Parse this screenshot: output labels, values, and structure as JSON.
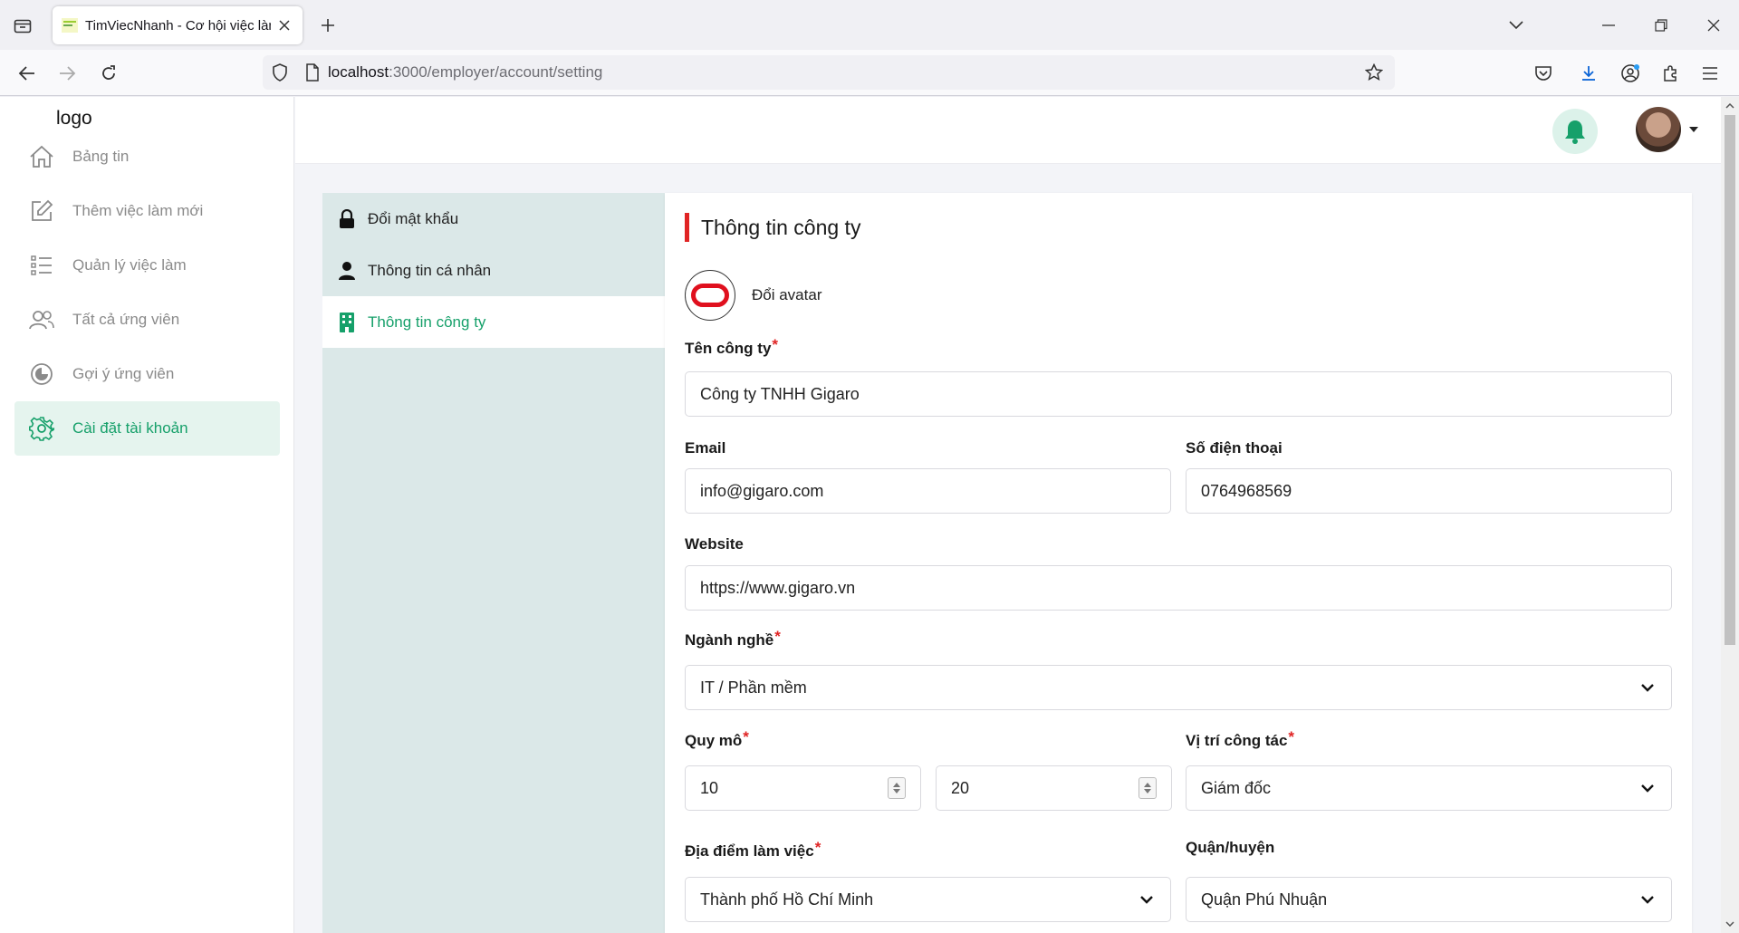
{
  "browser": {
    "tab_title": "TimViecNhanh - Cơ hội việc làm",
    "url_host": "localhost",
    "url_path": ":3000/employer/account/setting"
  },
  "sidebar": {
    "logo": "logo",
    "items": [
      {
        "label": "Bảng tin",
        "icon": "home-icon"
      },
      {
        "label": "Thêm việc làm mới",
        "icon": "edit-icon"
      },
      {
        "label": "Quản lý việc làm",
        "icon": "list-icon"
      },
      {
        "label": "Tất cả ứng viên",
        "icon": "users-icon"
      },
      {
        "label": "Gợi ý ứng viên",
        "icon": "pie-icon"
      },
      {
        "label": "Cài đặt tài khoản",
        "icon": "gear-icon"
      }
    ]
  },
  "settings_menu": [
    {
      "label": "Đổi mật khẩu",
      "icon": "lock-icon"
    },
    {
      "label": "Thông tin cá nhân",
      "icon": "user-icon"
    },
    {
      "label": "Thông tin công ty",
      "icon": "building-icon"
    }
  ],
  "form": {
    "title": "Thông tin công ty",
    "change_avatar": "Đổi avatar",
    "company_name_label": "Tên công ty",
    "company_name": "Công ty TNHH Gigaro",
    "email_label": "Email",
    "email": "info@gigaro.com",
    "phone_label": "Số điện thoại",
    "phone": "0764968569",
    "website_label": "Website",
    "website": "https://www.gigaro.vn",
    "industry_label": "Ngành nghề",
    "industry": "IT / Phần mềm",
    "size_label": "Quy mô",
    "size_min": "10",
    "size_max": "20",
    "position_label": "Vị trí công tác",
    "position": "Giám đốc",
    "location_label": "Địa điểm làm việc",
    "location": "Thành phố Hồ Chí Minh",
    "district_label": "Quận/huyện",
    "district": "Quận Phú Nhuận",
    "required_mark": "*"
  },
  "colors": {
    "accent_green": "#16a06a",
    "required_red": "#e02424",
    "menu_bg": "#dbe8e8"
  }
}
